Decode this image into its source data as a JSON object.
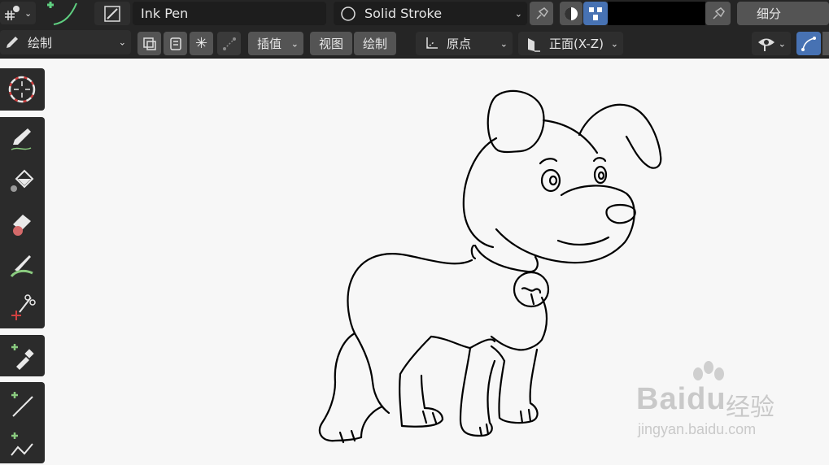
{
  "header": {
    "brush_name": "Ink Pen",
    "material_name": "Solid Stroke",
    "subdivide_label": "细分",
    "color": "#000000"
  },
  "tool_header": {
    "mode_label": "绘制",
    "interpolate_label": "插值",
    "view_label": "视图",
    "draw_label": "绘制",
    "origin_label": "原点",
    "orientation_label": "正面(X-Z)"
  },
  "colors": {
    "bar": "#252525",
    "button": "#545454",
    "active": "#4772b3",
    "canvas": "#f7f7f7",
    "stroke": "#000000"
  },
  "toolbar": {
    "tools": [
      "cursor-icon",
      "draw-icon",
      "fill-icon",
      "erase-icon",
      "tint-icon",
      "cutter-icon",
      "eyedropper-icon",
      "line-icon",
      "polyline-icon"
    ]
  },
  "watermark": {
    "logo": "Baidu",
    "text": "经验",
    "url": "jingyan.baidu.com"
  }
}
